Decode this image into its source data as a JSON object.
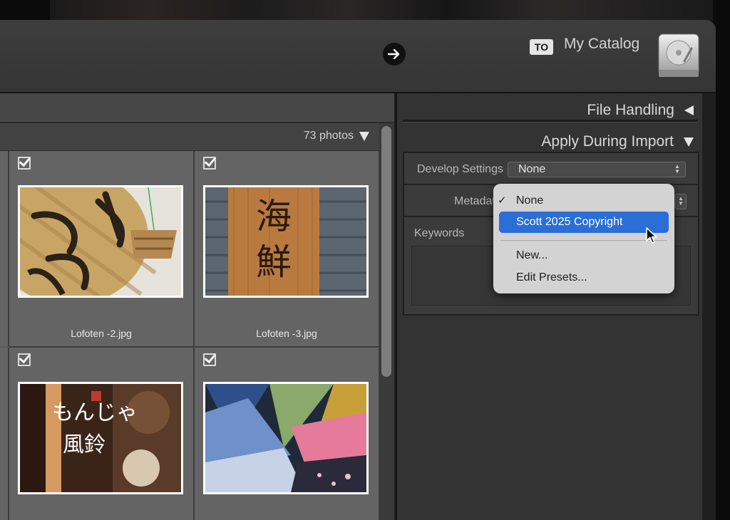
{
  "topbar": {
    "to_badge": "TO",
    "catalog_label": "My Catalog",
    "arrow_icon": "arrow-right-icon",
    "drive_icon": "hard-drive-icon"
  },
  "grid": {
    "photo_count": "73 photos",
    "cells": [
      {
        "label": "Lofoten -2.jpg",
        "checked": true
      },
      {
        "label": "Lofoten -3.jpg",
        "checked": true
      },
      {
        "label": "",
        "checked": true
      },
      {
        "label": "",
        "checked": true
      }
    ]
  },
  "right_panel": {
    "file_handling": "File Handling",
    "apply_during_import": "Apply During Import",
    "develop_settings_label": "Develop Settings",
    "develop_settings_value": "None",
    "metadata_label": "Metadata",
    "keywords_label": "Keywords"
  },
  "menu": {
    "items": [
      {
        "label": "None",
        "checked": true
      },
      {
        "label": "Scott 2025 Copyright",
        "selected": true
      },
      {
        "label": "New..."
      },
      {
        "label": "Edit Presets..."
      }
    ]
  },
  "colors": {
    "menu_highlight": "#2a6ed6",
    "panel_bg": "#333333",
    "grid_bg": "#5b5b5b"
  }
}
